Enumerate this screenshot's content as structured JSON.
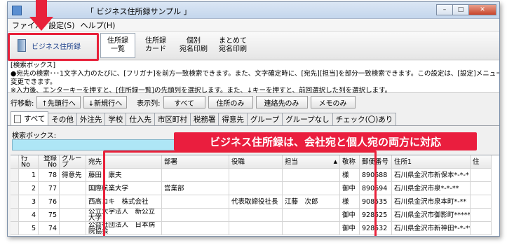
{
  "window": {
    "title": "「 ビジネス住所録サンプル 」",
    "controls": [
      "–",
      "□",
      "✕"
    ]
  },
  "menu": [
    "ファイル",
    "設定(S)",
    "ヘルプ(H)"
  ],
  "toolbar": {
    "main_label": "ビジネス住所録",
    "buttons": [
      {
        "label": "住所録\n一覧"
      },
      {
        "label": "住所録\nカード"
      },
      {
        "label": "個別\n宛名印刷"
      },
      {
        "label": "まとめて\n宛名印刷"
      }
    ]
  },
  "search_help": {
    "heading": "[検索ボックス]",
    "line1": "●宛先の検索･･･1文字入力のたびに、[フリガナ]を前方一致検索できます。また、文字確定時に、[宛先][担当]を部分一致検索できます。この設定は、[設定]メニュー - [オプション]で",
    "line2": "変更できます。",
    "line3": "※入力後、エンターキーを押すと、[住所録一覧]の先頭列を選択します。また、↓キーを押すと、前回選択した列を選択します。"
  },
  "navrow": {
    "move_label": "行移動:",
    "first_btn": "↑先頭行へ",
    "new_btn": "↓新規行へ",
    "display_label": "表示列:",
    "view_buttons": [
      "すべて",
      "住所のみ",
      "連絡先のみ",
      "メモのみ"
    ]
  },
  "tabs": [
    "すべて",
    "その他",
    "外注先",
    "学校",
    "仕入先",
    "市区町村",
    "税務署",
    "得意先",
    "グループ",
    "グループなし",
    "チェック(〇)あり"
  ],
  "keyword": {
    "label": "検索ボックス:",
    "value": ""
  },
  "grid": {
    "headers": [
      "行No",
      "登録\nNo",
      "グループ",
      "宛先",
      "部署",
      "役職",
      "担当",
      "▲",
      "敬称",
      "郵便番号",
      "住所1",
      "住"
    ],
    "rows": [
      {
        "row": "1",
        "reg": "78",
        "group": "得意先",
        "to": "藤田　康夫",
        "dept": "",
        "title": "",
        "person": "",
        "honor": "様",
        "zip": "890688",
        "addr": "石川県金沢市新保本*-*-*"
      },
      {
        "row": "2",
        "reg": "77",
        "group": "",
        "to": "国際航業大学",
        "dept": "営業部",
        "title": "",
        "person": "",
        "honor": "御中",
        "zip": "890694",
        "addr": "石川県金沢市泉*-*-**"
      },
      {
        "row": "3",
        "reg": "76",
        "group": "",
        "to": "西高コキ　株式会社",
        "dept": "",
        "title": "代表取締役社長",
        "person": "江藤　次郎",
        "honor": "様",
        "zip": "908535",
        "addr": "石川県金沢市泉本町*-**"
      },
      {
        "row": "4",
        "reg": "75",
        "group": "",
        "to": "公立大学法人　新公立大学",
        "dept": "",
        "title": "",
        "person": "",
        "honor": "御中",
        "zip": "928525",
        "addr": "石川県金沢市御影町*****"
      },
      {
        "row": "5",
        "reg": "74",
        "group": "",
        "to": "公益社団法人　日本病院協会",
        "dept": "",
        "title": "",
        "person": "",
        "honor": "御中",
        "zip": "928532",
        "addr": "石川県金沢市新神田*-*-**"
      }
    ]
  },
  "callout_text": "ビジネス住所録は、会社宛と個人宛の両方に対応",
  "colors": {
    "accent_red": "#e8213a",
    "keyword_bg": "#aee6f6"
  }
}
